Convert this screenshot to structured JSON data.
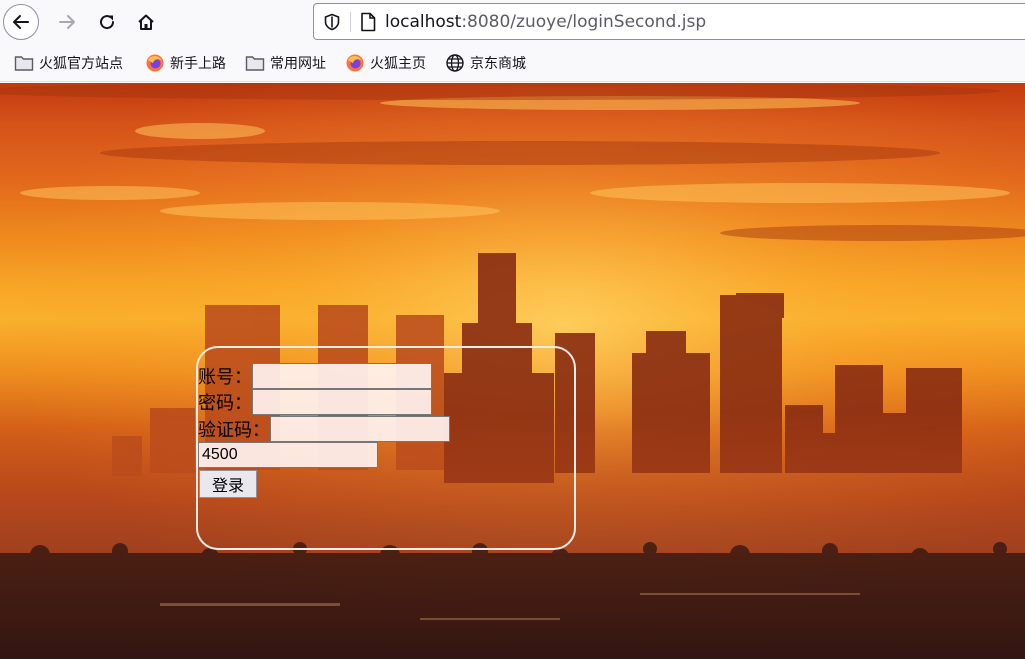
{
  "browser": {
    "url_host": "localhost",
    "url_rest": ":8080/zuoye/loginSecond.jsp",
    "icons": {
      "back": "back-arrow-icon",
      "forward": "forward-arrow-icon",
      "reload": "reload-icon",
      "home": "home-icon",
      "tracking": "shield-icon",
      "page": "page-icon"
    }
  },
  "bookmarks": [
    {
      "label": "火狐官方站点",
      "icon": "folder-icon"
    },
    {
      "label": "新手上路",
      "icon": "firefox-icon"
    },
    {
      "label": "常用网址",
      "icon": "folder-icon"
    },
    {
      "label": "火狐主页",
      "icon": "firefox-icon"
    },
    {
      "label": "京东商城",
      "icon": "globe-icon"
    }
  ],
  "login": {
    "account_label": "账号：",
    "account_value": "",
    "password_label": "密码：",
    "password_value": "",
    "captcha_label": "验证码：",
    "captcha_value": "",
    "captcha_code": "4500",
    "submit_label": "登录"
  },
  "colors": {
    "sky_top": "#c23a0e",
    "sky_glow": "#f9b12c",
    "ground": "#4e221c",
    "box_border": "#f4ece6"
  }
}
